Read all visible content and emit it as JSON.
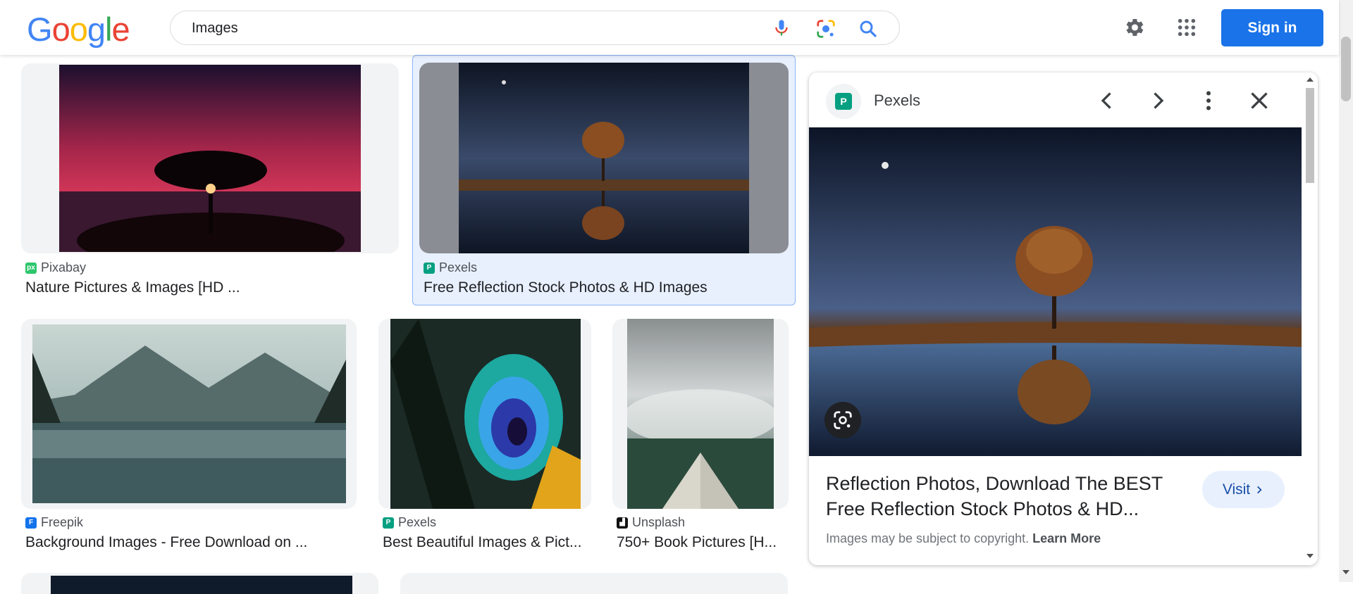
{
  "header": {
    "search_value": "Images",
    "signin_label": "Sign in",
    "logo_letters": [
      "G",
      "o",
      "o",
      "g",
      "l",
      "e"
    ],
    "logo_colors": [
      "#4285f4",
      "#ea4335",
      "#fbbc05",
      "#4285f4",
      "#34a853",
      "#ea4335"
    ]
  },
  "results": [
    {
      "source": "Pixabay",
      "title": "Nature Pictures & Images [HD ..."
    },
    {
      "source": "Pexels",
      "title": "Free Reflection Stock Photos & HD Images"
    },
    {
      "source": "Freepik",
      "title": "Background Images - Free Download on ..."
    },
    {
      "source": "Pexels",
      "title": "Best Beautiful Images & Pict..."
    },
    {
      "source": "Unsplash",
      "title": "750+ Book Pictures [H..."
    }
  ],
  "panel": {
    "source": "Pexels",
    "title": "Reflection Photos, Download The BEST Free Reflection Stock Photos & HD...",
    "visit_label": "Visit",
    "copyright_text": "Images may be subject to copyright.",
    "learn_more": "Learn More"
  },
  "colors": {
    "accent": "#1a73e8",
    "selected_bg": "#e8f0fe",
    "visit_text": "#174ea6"
  }
}
